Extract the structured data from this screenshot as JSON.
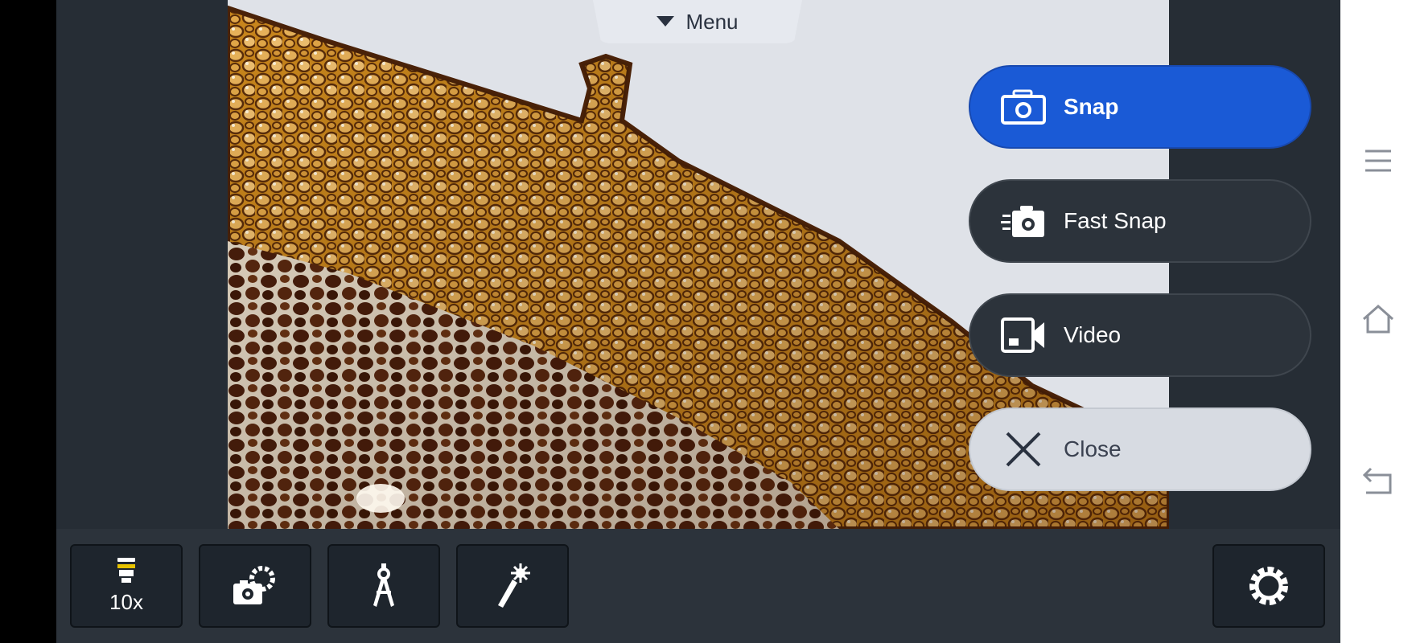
{
  "menu": {
    "label": "Menu",
    "icon": "caret-down-icon"
  },
  "actions": {
    "snap": {
      "label": "Snap",
      "icon": "camera-icon"
    },
    "fast_snap": {
      "label": "Fast Snap",
      "icon": "fast-camera-icon"
    },
    "video": {
      "label": "Video",
      "icon": "video-camera-icon"
    },
    "close": {
      "label": "Close",
      "icon": "close-icon"
    }
  },
  "toolbar": {
    "objective": {
      "label": "10x",
      "icon": "objective-lens-icon"
    },
    "camera_settings_icon": "camera-gear-icon",
    "measure_icon": "compass-icon",
    "illumination_icon": "light-wand-icon",
    "settings_icon": "gear-icon"
  },
  "system_nav": {
    "menu_icon": "hamburger-icon",
    "home_icon": "home-icon",
    "back_icon": "back-icon"
  },
  "colors": {
    "accent": "#1a5ad6",
    "app_background": "#262d35",
    "toolbar": "#2c333b"
  }
}
